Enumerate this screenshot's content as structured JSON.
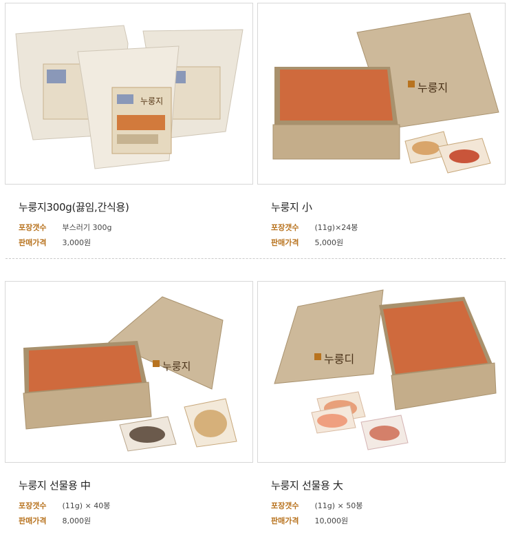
{
  "products": [
    {
      "title": "누룽지300g(끓임,간식용)",
      "pack_label": "포장갯수",
      "pack_value": "부스러기 300g",
      "price_label": "판매가격",
      "price_value": "3,000원",
      "image": "kraft-pouch-bags",
      "logo_text": "누룽지"
    },
    {
      "title": "누룽지 小",
      "pack_label": "포장갯수",
      "pack_value": "(11g)×24봉",
      "price_label": "판매가격",
      "price_value": "5,000원",
      "image": "kraft-gift-box-small",
      "logo_text": "누룽지"
    },
    {
      "title": "누룽지 선물용 中",
      "pack_label": "포장갯수",
      "pack_value": "(11g) × 40봉",
      "price_label": "판매가격",
      "price_value": "8,000원",
      "image": "kraft-gift-box-medium",
      "logo_text": "누룽지"
    },
    {
      "title": "누룽지 선물용 大",
      "pack_label": "포장갯수",
      "pack_value": "(11g) × 50봉",
      "price_label": "판매가격",
      "price_value": "10,000원",
      "image": "kraft-gift-box-large",
      "logo_text": "누룽디"
    }
  ],
  "colors": {
    "label": "#b8731f",
    "kraft": "#c9b596",
    "kraft_dark": "#a8916d",
    "cracker": "#d46a3a"
  }
}
